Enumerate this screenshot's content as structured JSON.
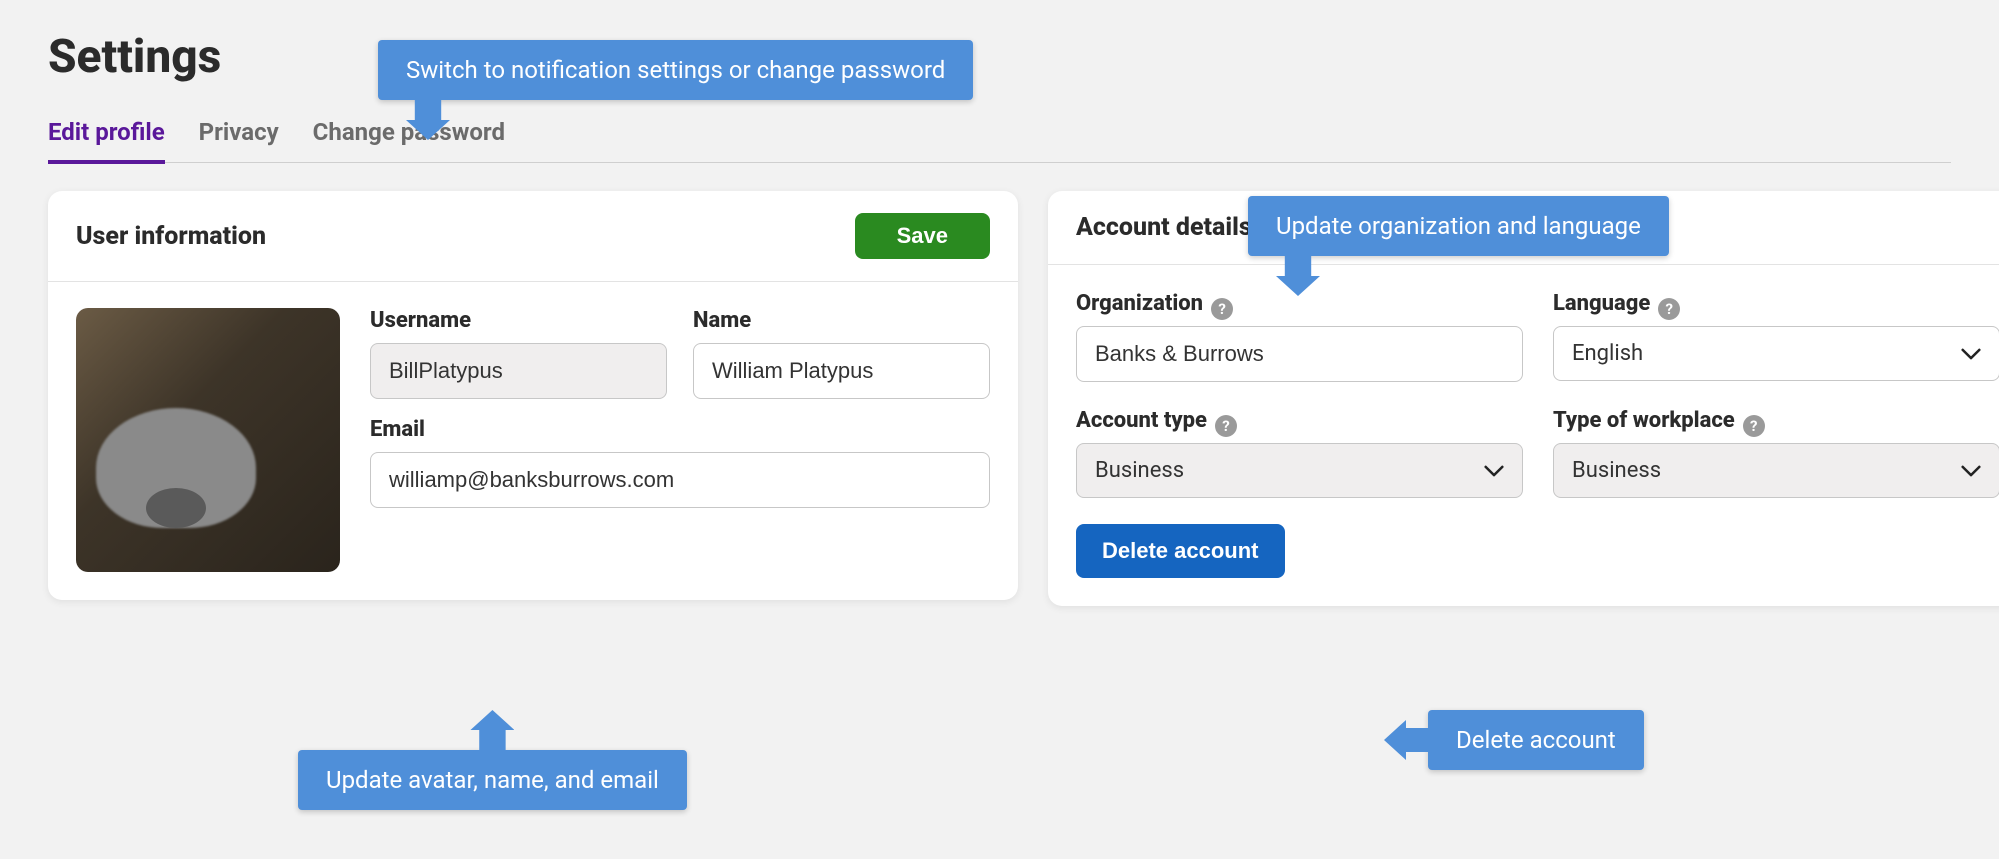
{
  "page": {
    "title": "Settings"
  },
  "tabs": {
    "edit_profile": "Edit profile",
    "privacy": "Privacy",
    "change_password": "Change password"
  },
  "user_card": {
    "title": "User information",
    "save_label": "Save",
    "username_label": "Username",
    "username_value": "BillPlatypus",
    "name_label": "Name",
    "name_value": "William Platypus",
    "email_label": "Email",
    "email_value": "williamp@banksburrows.com"
  },
  "account_card": {
    "title": "Account details",
    "organization_label": "Organization",
    "organization_value": "Banks & Burrows",
    "language_label": "Language",
    "language_value": "English",
    "account_type_label": "Account type",
    "account_type_value": "Business",
    "workplace_label": "Type of workplace",
    "workplace_value": "Business",
    "delete_label": "Delete account"
  },
  "annotations": {
    "tabs_note": "Switch to notification settings or change password",
    "user_note": "Update avatar, name, and email",
    "account_note": "Update organization and language",
    "delete_note": "Delete account"
  }
}
